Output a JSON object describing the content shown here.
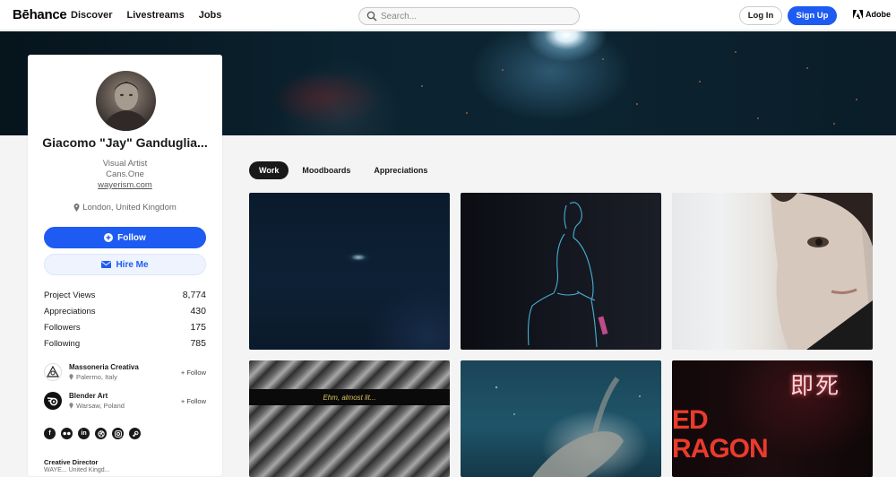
{
  "header": {
    "logo": "Bēhance",
    "nav": [
      "Discover",
      "Livestreams",
      "Jobs"
    ],
    "search_placeholder": "Search...",
    "login_label": "Log In",
    "signup_label": "Sign Up",
    "adobe_label": "Adobe"
  },
  "profile": {
    "name": "Giacomo \"Jay\" Ganduglia...",
    "title": "Visual Artist",
    "company": "Cans.One",
    "website": "wayerism.com",
    "location": "London, United Kingdom",
    "follow_label": "Follow",
    "hire_label": "Hire Me",
    "stats": [
      {
        "label": "Project Views",
        "value": "8,774"
      },
      {
        "label": "Appreciations",
        "value": "430"
      },
      {
        "label": "Followers",
        "value": "175"
      },
      {
        "label": "Following",
        "value": "785"
      }
    ],
    "member_of": [
      {
        "name": "Massoneria Creativa",
        "location": "Palermo, Italy",
        "follow": "+ Follow"
      },
      {
        "name": "Blender Art",
        "location": "Warsaw, Poland",
        "follow": "+ Follow"
      }
    ],
    "socials": [
      "facebook-icon",
      "flickr-icon",
      "linkedin-icon",
      "dribbble-icon",
      "instagram-icon",
      "steam-icon"
    ],
    "work_heading": "Creative Director",
    "work_sub": "WAYE... United Kingd..."
  },
  "tabs": [
    "Work",
    "Moodboards",
    "Appreciations"
  ],
  "active_tab": "Work",
  "projects": {
    "caption_tile4": "Ehm, almost lit...",
    "tile6_text_line1": "ED",
    "tile6_text_line2": "RAGON",
    "tile6_glyphs": "即死"
  },
  "colors": {
    "brand_blue": "#1d5bf2",
    "text_dark": "#191919",
    "page_bg": "#f4f4f4"
  }
}
